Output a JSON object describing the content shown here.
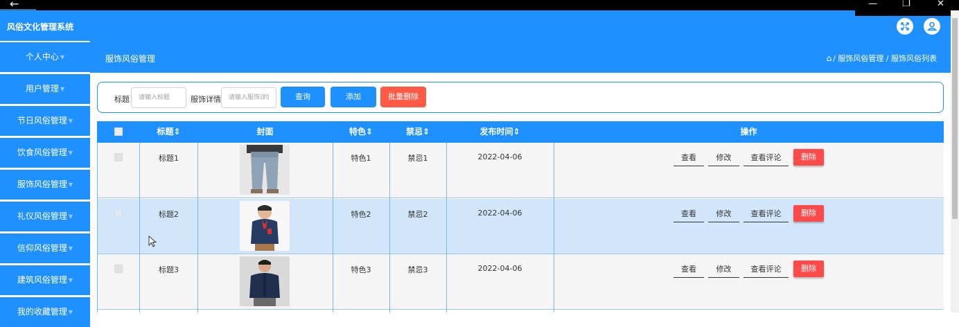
{
  "window": {
    "back_glyph": "←",
    "minimize_glyph": "—",
    "restore_glyph": "❐",
    "close_glyph": "✕"
  },
  "header": {
    "app_title": "风俗文化管理系统",
    "fullscreen_icon": "fullscreen-icon",
    "user_icon": "user-icon",
    "accent": "#1e90ff"
  },
  "sidebar": {
    "items": [
      {
        "label": "个人中心"
      },
      {
        "label": "用户管理"
      },
      {
        "label": "节日风俗管理"
      },
      {
        "label": "饮食风俗管理"
      },
      {
        "label": "服饰风俗管理"
      },
      {
        "label": "礼仪风俗管理"
      },
      {
        "label": "信仰风俗管理"
      },
      {
        "label": "建筑风俗管理"
      },
      {
        "label": "我的收藏管理"
      }
    ]
  },
  "page": {
    "title": "服饰风俗管理",
    "breadcrumb": "/ 服饰风俗管理 / 服饰风俗列表"
  },
  "search": {
    "title_label": "标题",
    "title_placeholder": "请输入标题",
    "detail_label": "服饰详情",
    "detail_placeholder": "请输入服饰详情",
    "query_button": "查询",
    "add_button": "添加",
    "batch_delete_button": "批量删除"
  },
  "table": {
    "columns": [
      "标题",
      "封面",
      "特色",
      "禁忌",
      "发布时间",
      "操作"
    ],
    "sort_glyph": "⇕",
    "rows": [
      {
        "title": "标题1",
        "feature": "特色1",
        "taboo": "禁忌1",
        "date": "2022-04-06"
      },
      {
        "title": "标题2",
        "feature": "特色2",
        "taboo": "禁忌2",
        "date": "2022-04-06"
      },
      {
        "title": "标题3",
        "feature": "特色3",
        "taboo": "禁忌3",
        "date": "2022-04-06"
      }
    ],
    "actions": {
      "view": "查看",
      "edit": "修改",
      "comments": "查看评论",
      "delete": "删除"
    },
    "row_colors": {
      "normal": "#f5f5f5",
      "hover": "#d2e6fb"
    }
  }
}
